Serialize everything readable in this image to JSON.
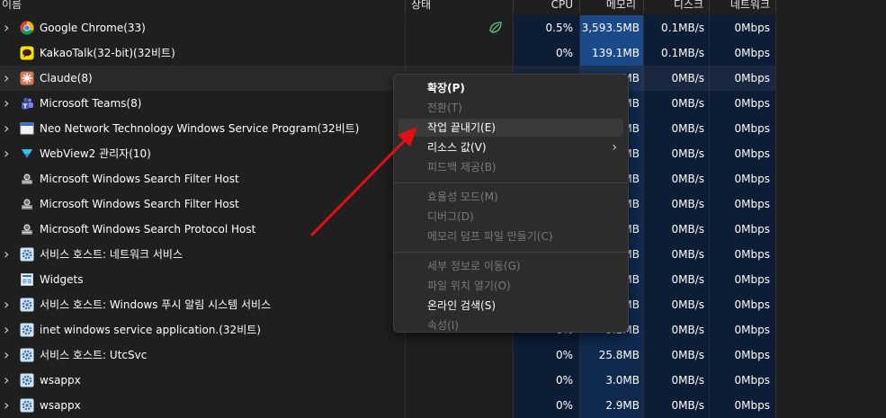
{
  "columns": {
    "name": "이름",
    "status": "상태",
    "cpu": "CPU",
    "memory": "메모리",
    "disk": "디스크",
    "network": "네트워크"
  },
  "processes": [
    {
      "name": "Google Chrome(33)",
      "expandable": true,
      "icon": "chrome-icon",
      "status": "eco-leaf-icon",
      "cpu": "0.5%",
      "memory": "3,593.5MB",
      "disk": "0.1MB/s",
      "network": "0Mbps"
    },
    {
      "name": "KakaoTalk(32-bit)(32비트)",
      "expandable": false,
      "icon": "kakaotalk-icon",
      "cpu": "0%",
      "memory": "139.1MB",
      "disk": "0.1MB/s",
      "network": "0Mbps"
    },
    {
      "name": "Claude(8)",
      "expandable": true,
      "icon": "claude-icon",
      "cpu": "",
      "memory": "MB",
      "disk": "0MB/s",
      "network": "0Mbps"
    },
    {
      "name": "Microsoft Teams(8)",
      "expandable": true,
      "icon": "teams-icon",
      "cpu": "",
      "memory": "MB",
      "disk": "0MB/s",
      "network": "0Mbps"
    },
    {
      "name": "Neo Network Technology Windows Service Program(32비트)",
      "expandable": true,
      "icon": "window-app-icon",
      "cpu": "",
      "memory": "MB",
      "disk": "0MB/s",
      "network": "0Mbps"
    },
    {
      "name": "WebView2 관리자(10)",
      "expandable": true,
      "icon": "webview-icon",
      "cpu": "",
      "memory": "MB",
      "disk": "0MB/s",
      "network": "0Mbps"
    },
    {
      "name": "Microsoft Windows Search Filter Host",
      "expandable": false,
      "icon": "search-host-icon",
      "cpu": "",
      "memory": "MB",
      "disk": "0MB/s",
      "network": "0Mbps"
    },
    {
      "name": "Microsoft Windows Search Filter Host",
      "expandable": false,
      "icon": "search-host-icon",
      "cpu": "",
      "memory": "MB",
      "disk": "0MB/s",
      "network": "0Mbps"
    },
    {
      "name": "Microsoft Windows Search Protocol Host",
      "expandable": false,
      "icon": "search-host-icon",
      "cpu": "",
      "memory": "MB",
      "disk": "0MB/s",
      "network": "0Mbps"
    },
    {
      "name": "서비스 호스트: 네트워크 서비스",
      "expandable": true,
      "icon": "service-gear-icon",
      "cpu": "",
      "memory": "MB",
      "disk": "0MB/s",
      "network": "0Mbps"
    },
    {
      "name": "Widgets",
      "expandable": false,
      "icon": "widgets-icon",
      "cpu": "",
      "memory": "MB",
      "disk": "0MB/s",
      "network": "0Mbps"
    },
    {
      "name": "서비스 호스트: Windows 푸시 알림 시스템 서비스",
      "expandable": true,
      "icon": "service-gear-icon",
      "cpu": "",
      "memory": "MB",
      "disk": "0MB/s",
      "network": "0Mbps"
    },
    {
      "name": "inet windows service application.(32비트)",
      "expandable": true,
      "icon": "service-gear-icon",
      "cpu": "0%",
      "memory": "9.2MB",
      "disk": "0MB/s",
      "network": "0Mbps"
    },
    {
      "name": "서비스 호스트: UtcSvc",
      "expandable": true,
      "icon": "service-gear-icon",
      "cpu": "0%",
      "memory": "25.8MB",
      "disk": "0MB/s",
      "network": "0Mbps"
    },
    {
      "name": "wsappx",
      "expandable": true,
      "icon": "service-gear-icon",
      "cpu": "0%",
      "memory": "3.0MB",
      "disk": "0MB/s",
      "network": "0Mbps"
    },
    {
      "name": "wsappx",
      "expandable": true,
      "icon": "service-gear-icon",
      "cpu": "0%",
      "memory": "2.9MB",
      "disk": "0MB/s",
      "network": "0Mbps"
    }
  ],
  "context_menu": {
    "items": [
      {
        "label": "확장(P)",
        "enabled": true,
        "bold": true
      },
      {
        "label": "전환(T)",
        "enabled": false
      },
      {
        "label": "작업 끝내기(E)",
        "enabled": true,
        "highlighted": true
      },
      {
        "label": "리소스 값(V)",
        "enabled": true,
        "submenu": true
      },
      {
        "label": "피드백 제공(B)",
        "enabled": false
      },
      {
        "separator": true
      },
      {
        "label": "효율성 모드(M)",
        "enabled": false
      },
      {
        "label": "디버그(D)",
        "enabled": false
      },
      {
        "label": "메모리 덤프 파일 만들기(C)",
        "enabled": false
      },
      {
        "separator": true
      },
      {
        "label": "세부 정보로 이동(G)",
        "enabled": false
      },
      {
        "label": "파일 위치 열기(O)",
        "enabled": false
      },
      {
        "label": "온라인 검색(S)",
        "enabled": true
      },
      {
        "label": "속성(I)",
        "enabled": false
      }
    ]
  },
  "colors": {
    "background": "#1f1f1f",
    "memory_column": "#0f2a4e",
    "memory_column_strong": "#1a4a8a",
    "cpu_column": "#0d1d36",
    "disk_column": "#0d1d36",
    "network_column": "#0d1d36",
    "arrow": "#e01010"
  }
}
